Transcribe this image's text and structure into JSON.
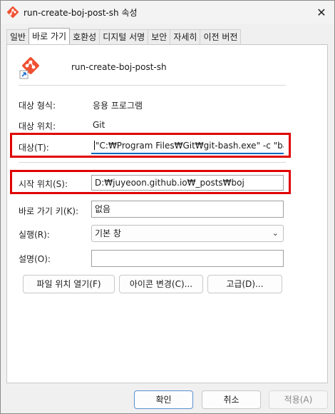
{
  "window": {
    "title": "run-create-boj-post-sh 속성",
    "close_glyph": "✕"
  },
  "tabs": [
    {
      "label": "일반",
      "active": false
    },
    {
      "label": "바로 가기",
      "active": true
    },
    {
      "label": "호환성",
      "active": false
    },
    {
      "label": "디지털 서명",
      "active": false
    },
    {
      "label": "보안",
      "active": false
    },
    {
      "label": "자세히",
      "active": false
    },
    {
      "label": "이전 버전",
      "active": false
    }
  ],
  "shortcut": {
    "name": "run-create-boj-post-sh",
    "target_type_label": "대상 형식:",
    "target_type_value": "응용 프로그램",
    "target_location_label": "대상 위치:",
    "target_location_value": "Git",
    "target_label": "대상(T):",
    "target_value": "\"C:₩Program Files₩Git₩git-bash.exe\" -c \"bash -i",
    "start_in_label": "시작 위치(S):",
    "start_in_value": "D:₩juyeoon.github.io₩_posts₩boj",
    "hotkey_label": "바로 가기 키(K):",
    "hotkey_value": "없음",
    "run_label": "실행(R):",
    "run_value": "기본 창",
    "comment_label": "설명(O):",
    "comment_value": ""
  },
  "buttons": {
    "open_location": "파일 위치 열기(F)",
    "change_icon": "아이콘 변경(C)...",
    "advanced": "고급(D)...",
    "ok": "확인",
    "cancel": "취소",
    "apply": "적용(A)"
  },
  "colors": {
    "highlight": "#e00000",
    "focus_underline": "#0067c0",
    "git_orange": "#f05032"
  },
  "icons": {
    "app": "git-icon",
    "chevron": "chevron-down-icon",
    "close": "close-icon"
  }
}
